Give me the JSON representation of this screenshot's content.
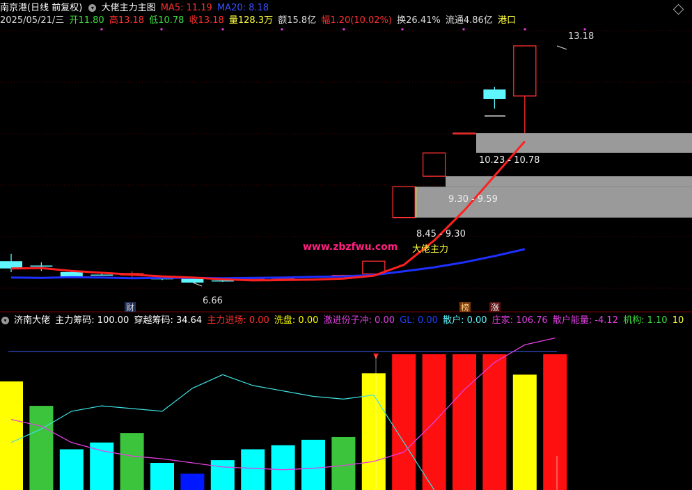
{
  "header": {
    "stock_name": "南京港(日线 前复权)",
    "indicator_name": "大佬主力主图",
    "ma5_label": "MA5: 11.19",
    "ma20_label": "MA20: 8.18",
    "date": "2025/05/21/三",
    "open": "开11.80",
    "high": "高13.18",
    "low": "低10.78",
    "close": "收13.18",
    "volume": "量128.3万",
    "amount": "额15.8亿",
    "change": "幅1.20(10.02%)",
    "turnover": "换26.41%",
    "float_cap": "流通4.86亿",
    "sector": "港口"
  },
  "sub_header": {
    "name": "济南大佬",
    "main_chip": "主力筹码: 100.00",
    "cross_chip": "穿越筹码: 34.64",
    "main_entry": "主力进场: 0.00",
    "wash": "洗盘: 0.00",
    "aggressive": "激进份子冲: 0.00",
    "gl": "GL: 0.00",
    "retail": "散户: 0.00",
    "dealer": "庄家: 106.76",
    "retail_energy": "散户能量: -4.12",
    "institution": "机构: 1.10",
    "more": "10"
  },
  "annotations": {
    "high_price": "13.18",
    "low_price": "6.66",
    "zone1": "10.23 - 10.78",
    "zone2": "9.30 - 9.59",
    "zone3": "8.45 - 9.30",
    "watermark": "www.zbzfwu.com",
    "dalao": "大佬主力",
    "event_cai": "财",
    "event_bang": "榜",
    "event_zhang": "涨"
  },
  "colors": {
    "up": "#ff3030",
    "down": "#5ff6ff",
    "ma5": "#ff2020",
    "ma20": "#1e30ff",
    "zone": "#9a9a9a",
    "yellow": "#ffff00",
    "green": "#3cc43c",
    "cyan": "#00ffff",
    "blue": "#0018ff",
    "magenta": "#e040e0"
  },
  "chart_data": [
    {
      "type": "candlestick",
      "title": "大佬主力主图",
      "ylim": [
        6.2,
        13.6
      ],
      "candles": [
        {
          "o": 7.25,
          "h": 7.45,
          "l": 6.95,
          "c": 7.05
        },
        {
          "o": 7.13,
          "h": 7.22,
          "l": 6.98,
          "c": 7.1
        },
        {
          "o": 6.95,
          "h": 6.96,
          "l": 6.82,
          "c": 6.82
        },
        {
          "o": 6.88,
          "h": 6.9,
          "l": 6.85,
          "c": 6.86
        },
        {
          "o": 6.87,
          "h": 6.97,
          "l": 6.8,
          "c": 6.91
        },
        {
          "o": 6.8,
          "h": 6.82,
          "l": 6.73,
          "c": 6.75
        },
        {
          "o": 6.77,
          "h": 6.78,
          "l": 6.66,
          "c": 6.66
        },
        {
          "o": 6.72,
          "h": 6.74,
          "l": 6.68,
          "c": 6.69
        },
        {
          "o": 6.75,
          "h": 6.78,
          "l": 6.7,
          "c": 6.77
        },
        {
          "o": 6.78,
          "h": 6.82,
          "l": 6.76,
          "c": 6.8
        },
        {
          "o": 6.83,
          "h": 6.84,
          "l": 6.8,
          "c": 6.82
        },
        {
          "o": 6.84,
          "h": 6.87,
          "l": 6.81,
          "c": 6.86
        },
        {
          "o": 6.9,
          "h": 7.25,
          "l": 6.88,
          "c": 7.25
        },
        {
          "o": 8.45,
          "h": 9.3,
          "l": 8.45,
          "c": 9.3
        },
        {
          "o": 9.59,
          "h": 10.23,
          "l": 9.59,
          "c": 10.23
        },
        {
          "o": 10.78,
          "h": 10.79,
          "l": 10.77,
          "c": 10.78
        },
        {
          "o": 11.98,
          "h": 12.05,
          "l": 11.45,
          "c": 11.72
        },
        {
          "o": 11.8,
          "h": 13.18,
          "l": 10.78,
          "c": 13.18
        }
      ],
      "ma5": [
        7.05,
        7.06,
        6.98,
        6.93,
        6.88,
        6.83,
        6.8,
        6.75,
        6.72,
        6.73,
        6.74,
        6.77,
        6.85,
        7.15,
        7.82,
        8.65,
        9.6,
        10.55
      ],
      "ma20": [
        6.8,
        6.79,
        6.81,
        6.8,
        6.78,
        6.79,
        6.79,
        6.78,
        6.79,
        6.8,
        6.82,
        6.83,
        6.87,
        6.97,
        7.08,
        7.22,
        7.39,
        7.58
      ],
      "zones": [
        {
          "low": 10.23,
          "high": 10.78,
          "label": "10.23 - 10.78"
        },
        {
          "low": 9.3,
          "high": 9.59,
          "label": "9.30 - 9.59"
        },
        {
          "low": 8.45,
          "high": 9.3,
          "label": "8.45 - 9.30"
        }
      ]
    },
    {
      "type": "bar",
      "title": "济南大佬",
      "ylim": [
        0,
        120
      ],
      "ref_line": 102,
      "series": [
        {
          "name": "主力筹码",
          "values": [
            80,
            62,
            30,
            35,
            42,
            20,
            12,
            22,
            30,
            33,
            37,
            39,
            86,
            100,
            100,
            100,
            100,
            85,
            100
          ]
        },
        {
          "name": "穿越筹码",
          "values": [
            35,
            45,
            58,
            62,
            60,
            58,
            75,
            85,
            77,
            73,
            69,
            67,
            70,
            35,
            0,
            0,
            0,
            0,
            0
          ]
        },
        {
          "name": "庄家",
          "values": [
            52,
            47,
            35,
            29,
            25,
            23,
            20,
            17,
            16,
            15,
            16,
            18,
            21,
            28,
            50,
            74,
            94,
            107,
            112
          ]
        }
      ],
      "bar_colors": [
        "yellow",
        "green",
        "cyan",
        "cyan",
        "green",
        "cyan",
        "blue",
        "cyan",
        "cyan",
        "cyan",
        "cyan",
        "green",
        "yellow",
        "red",
        "red",
        "red",
        "red",
        "yellow",
        "red"
      ]
    }
  ]
}
